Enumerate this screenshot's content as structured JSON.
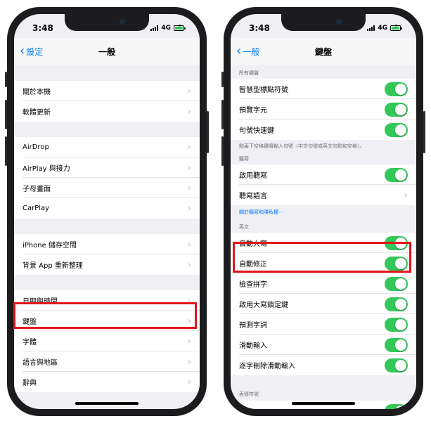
{
  "left_phone": {
    "status": {
      "time": "3:48",
      "network": "4G"
    },
    "nav": {
      "back_label": "設定",
      "title": "一般"
    },
    "groups": [
      [
        "關於本機",
        "軟體更新"
      ],
      [
        "AirDrop",
        "AirPlay 與接力",
        "子母畫面",
        "CarPlay"
      ],
      [
        "iPhone 儲存空間",
        "背景 App 重新整理"
      ],
      [
        "日期與時間",
        "鍵盤",
        "字體",
        "語言與地區",
        "辭典"
      ]
    ]
  },
  "right_phone": {
    "status": {
      "time": "3:48",
      "network": "4G"
    },
    "nav": {
      "back_label": "一般",
      "title": "鍵盤"
    },
    "sections": {
      "all_keyboards_header": "所有鍵盤",
      "smart_punctuation": "智慧型標點符號",
      "char_preview": "預覽字元",
      "period_shortcut": "句號快速鍵",
      "period_footer": "點兩下空格鍵將輸入句號（中文句號或英文句點和空格）。",
      "dictation_header": "聽寫",
      "enable_dictation": "啟用聽寫",
      "dictation_languages": "聽寫語言",
      "dictation_privacy_link": "關於聽寫和隱私權⋯",
      "english_header": "英文",
      "auto_capitalization": "自動大寫",
      "auto_correction": "自動修正",
      "check_spelling": "檢查拼字",
      "caps_lock": "啟用大寫鎖定鍵",
      "predictive": "預測字詞",
      "slide_to_type": "滑動輸入",
      "delete_slide_word": "逐字刪除滑動輸入",
      "emoji_header": "表情符號"
    }
  },
  "colors": {
    "accent": "#007aff",
    "toggle_on": "#34c759",
    "highlight": "#e3161b"
  }
}
